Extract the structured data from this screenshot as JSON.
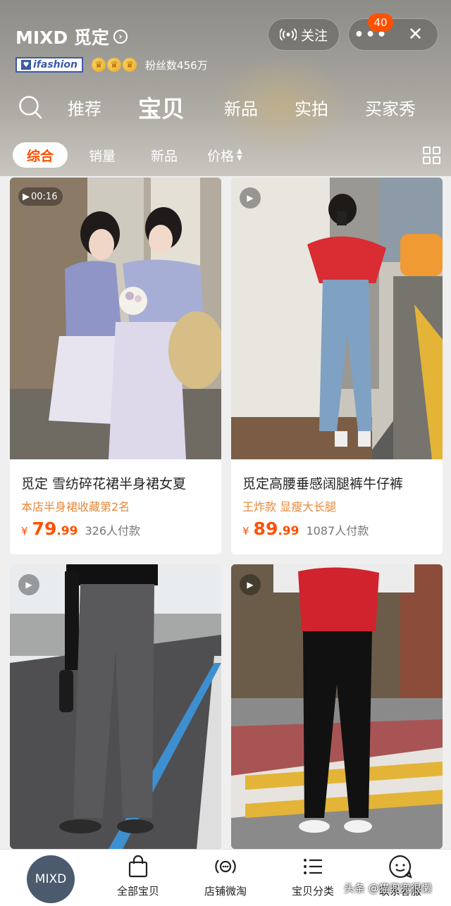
{
  "shop": {
    "name": "MIXD 觅定",
    "brand_badge": "ifashion",
    "fans": "粉丝数456万",
    "follow_label": "关注",
    "notification_count": "40"
  },
  "nav": {
    "tabs": [
      "推荐",
      "宝贝",
      "新品",
      "实拍",
      "买家秀"
    ],
    "active_tab": "宝贝"
  },
  "filters": {
    "items": [
      "综合",
      "销量",
      "新品",
      "价格"
    ],
    "active": "综合"
  },
  "products": [
    {
      "title": "觅定 雪纺碎花裙半身裙女夏",
      "subtitle": "本店半身裙收藏第2名",
      "currency": "¥",
      "price_int": "79",
      "price_dec": ".99",
      "paid": "326人付款",
      "video_duration": "00:16"
    },
    {
      "title": "觅定高腰垂感阔腿裤牛仔裤",
      "subtitle": "王炸款 显瘦大长腿",
      "currency": "¥",
      "price_int": "89",
      "price_dec": ".99",
      "paid": "1087人付款"
    }
  ],
  "bottom_nav": {
    "avatar": "MIXD",
    "items": [
      "全部宝贝",
      "店铺微淘",
      "宝贝分类",
      "联系客服"
    ]
  },
  "watermark": "头条 @猫兜兜很懒",
  "colors": {
    "accent": "#ff5000",
    "subtitle": "#e8883a"
  }
}
